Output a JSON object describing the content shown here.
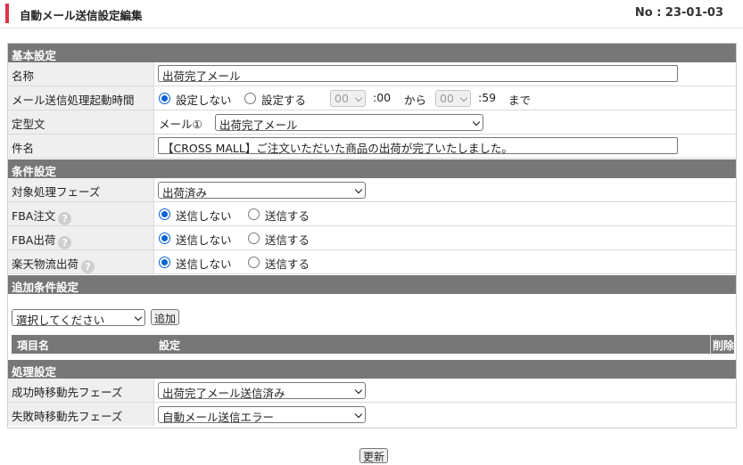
{
  "header": {
    "title": "自動メール送信設定編集",
    "doc_no": "No : 23-01-03"
  },
  "sections": {
    "basic": "基本設定",
    "conditions": "条件設定",
    "additional": "追加条件設定",
    "processing": "処理設定"
  },
  "basic": {
    "name_label": "名称",
    "name_value": "出荷完了メール",
    "time_label": "メール送信処理起動時間",
    "time_opt_off": "設定しない",
    "time_opt_on": "設定する",
    "time_selected": "設定しない",
    "from_hour": "00",
    "from_suffix": ":00",
    "from_word": "から",
    "to_hour": "00",
    "to_suffix": ":59",
    "to_word": "まで",
    "template_label": "定型文",
    "template_prefix": "メール①",
    "template_value": "出荷完了メール",
    "subject_label": "件名",
    "subject_value": "【CROSS MALL】ご注文いただいた商品の出荷が完了いたしました。"
  },
  "conditions": {
    "phase_label": "対象処理フェーズ",
    "phase_value": "出荷済み",
    "fba_order_label": "FBA注文",
    "fba_ship_label": "FBA出荷",
    "rakuten_label": "楽天物流出荷",
    "opt_no": "送信しない",
    "opt_yes": "送信する",
    "help_glyph": "?",
    "fba_order_selected": "送信しない",
    "fba_ship_selected": "送信しない",
    "rakuten_selected": "送信しない"
  },
  "additional": {
    "select_placeholder": "選択してください",
    "add_button": "追加",
    "col_item": "項目名",
    "col_setting": "設定",
    "col_delete": "削除"
  },
  "processing": {
    "success_label": "成功時移動先フェーズ",
    "success_value": "出荷完了メール送信済み",
    "failure_label": "失敗時移動先フェーズ",
    "failure_value": "自動メール送信エラー"
  },
  "footer": {
    "update_button": "更新"
  },
  "colors": {
    "accent": "#e0324b",
    "section_bg": "#777777",
    "radio_checked": "#0b63d6"
  }
}
